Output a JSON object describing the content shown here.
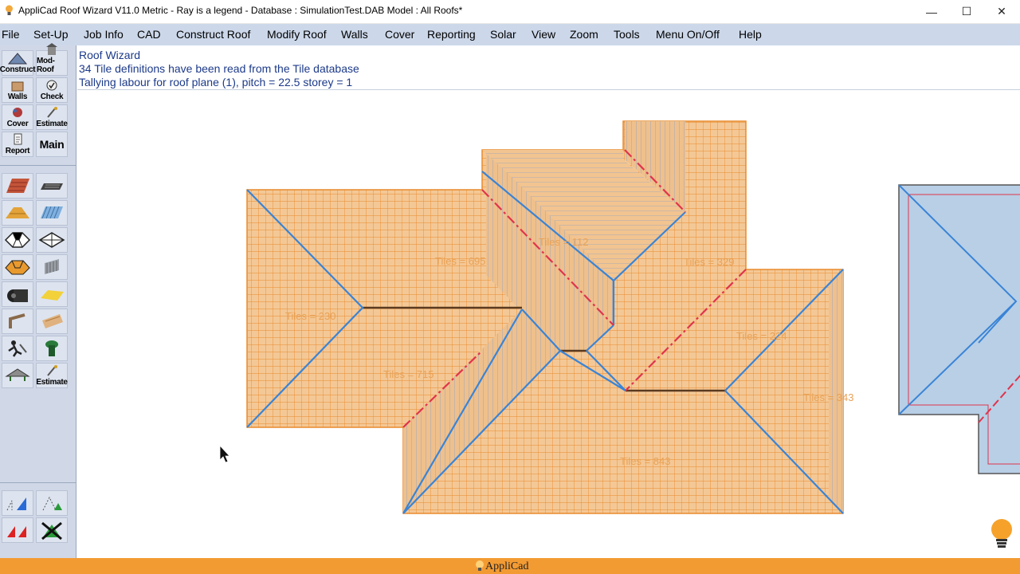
{
  "window": {
    "title": "AppliCad Roof Wizard V11.0 Metric - Ray is a legend - Database : SimulationTest.DAB   Model : All Roofs*",
    "controls": [
      "—",
      "☐",
      "✕"
    ]
  },
  "menu": [
    "File",
    "Set-Up",
    "Job Info",
    "CAD",
    "Construct Roof",
    "Modify Roof",
    "Walls",
    "Cover",
    "Reporting",
    "Solar",
    "View",
    "Zoom",
    "Tools",
    "Menu On/Off",
    "Help"
  ],
  "toolbar": {
    "labeled": [
      "Construct",
      "Mod-Roof",
      "Walls",
      "Check",
      "Cover",
      "Estimate",
      "Report",
      "Main"
    ],
    "last_label": "Estimate",
    "icons": [
      "tile-roof-icon",
      "metal-sheet-icon",
      "half-tile-icon",
      "corrugated-sheet-icon",
      "hip-roof-outline-icon",
      "pyramid-roof-icon",
      "hip-roof-tool-icon",
      "wall-panel-icon",
      "insulation-roll-icon",
      "foil-sheet-icon",
      "gutter-icon",
      "timber-plank-icon",
      "worker-icon",
      "downpipe-icon",
      "roof-truss-icon",
      "estimate-icon"
    ],
    "bottom_icons": [
      "pitch-blue-icon",
      "pitch-green-icon",
      "red-pitch-icon",
      "delete-pitch-icon"
    ]
  },
  "messages": [
    "Roof Wizard",
    "34 Tile definitions have been read from the Tile database",
    "Tallying labour for roof plane (1), pitch = 22.5 storey = 1"
  ],
  "roof_labels": [
    "Tiles = 695",
    "Tiles = 230",
    "Tiles = 715",
    "Tiles = 112",
    "Tiles = 329",
    "Tiles = 224",
    "Tiles = 343",
    "Tiles = 843"
  ],
  "colors": {
    "roof_fill": "#f4c896",
    "roof_line": "#e98a2c",
    "hip_line": "#3a84d6",
    "valley_line": "#e0344c",
    "roof2_fill": "#b8cfe6",
    "status_bar": "#f39b33"
  },
  "status": {
    "brand": "AppliCad"
  }
}
